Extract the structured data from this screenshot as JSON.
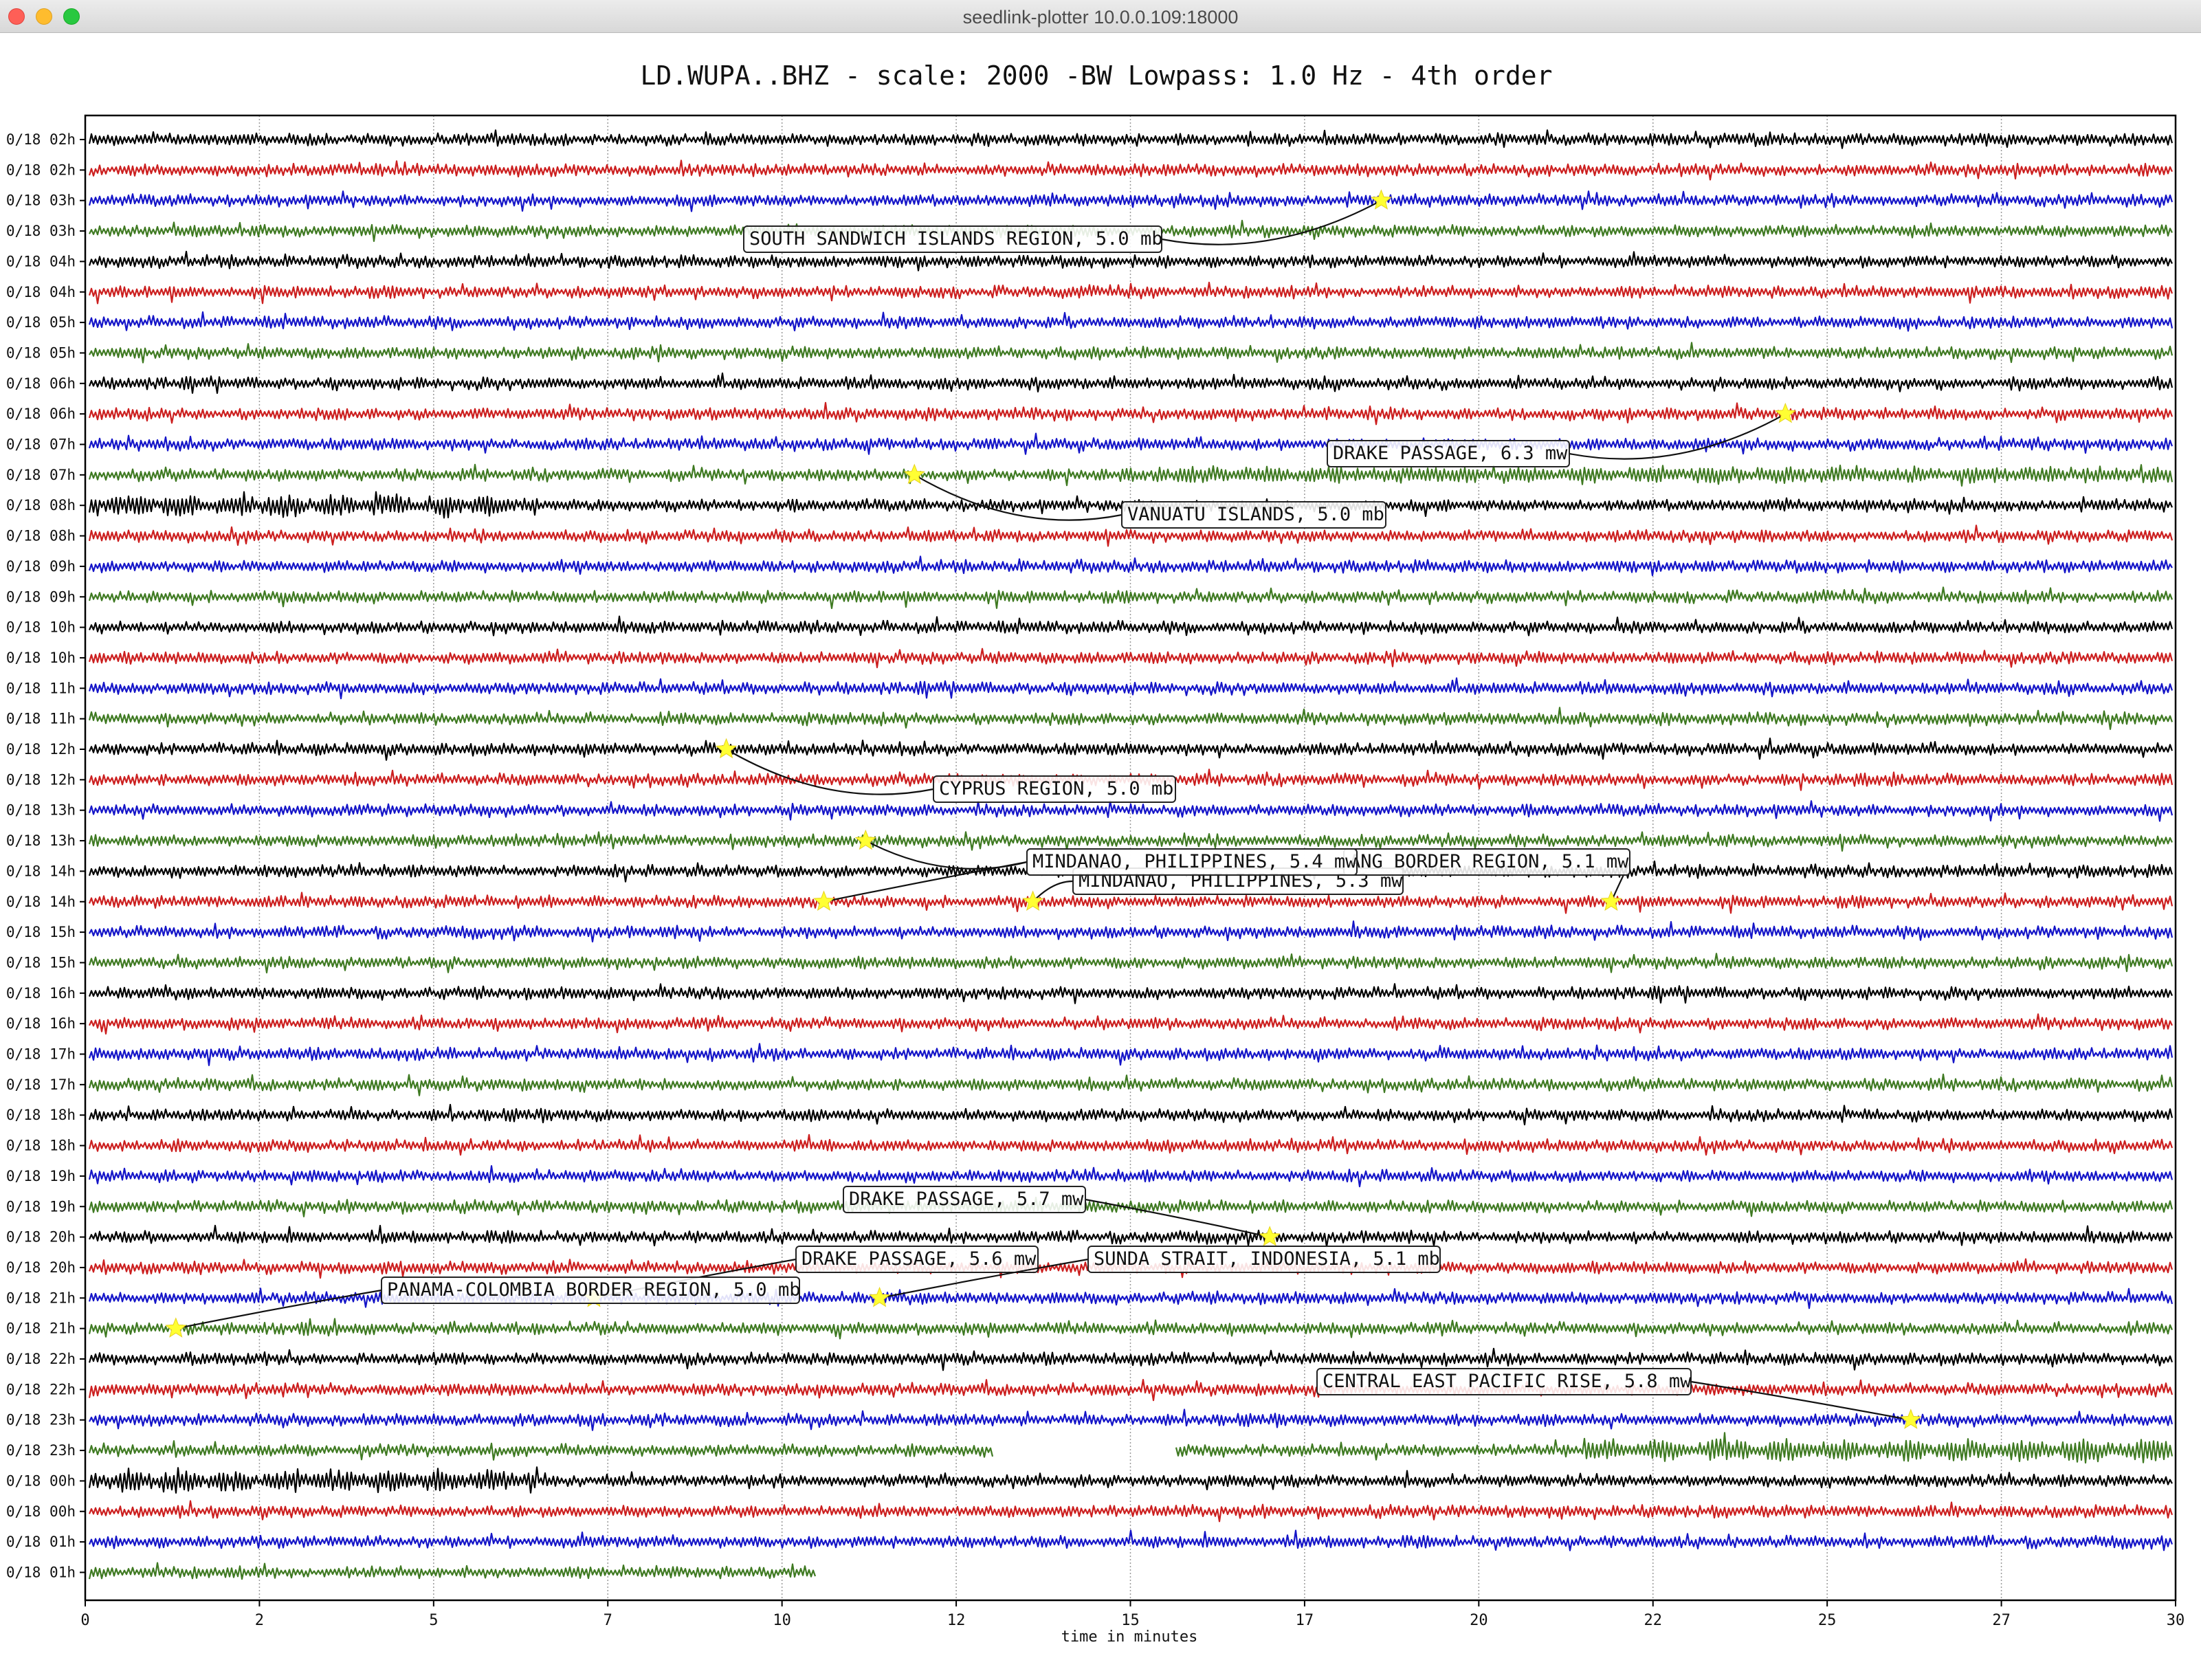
{
  "window": {
    "title": "seedlink-plotter 10.0.0.109:18000",
    "buttons": [
      "close",
      "minimize",
      "zoom"
    ]
  },
  "chart_data": {
    "type": "line",
    "title": "LD.WUPA..BHZ - scale: 2000 -BW Lowpass: 1.0 Hz - 4th order",
    "xlabel": "time in minutes",
    "ylabel": "",
    "xlim": [
      0,
      30
    ],
    "x_ticks": [
      "0",
      "2",
      "5",
      "7",
      "10",
      "12",
      "15",
      "17",
      "20",
      "22",
      "25",
      "27",
      "30"
    ],
    "grid": true,
    "line_colors": [
      "#000000",
      "#cc1f1f",
      "#1515c8",
      "#3f7a22"
    ],
    "row_labels": [
      "0/18 02h",
      "0/18 02h",
      "0/18 03h",
      "0/18 03h",
      "0/18 04h",
      "0/18 04h",
      "0/18 05h",
      "0/18 05h",
      "0/18 06h",
      "0/18 06h",
      "0/18 07h",
      "0/18 07h",
      "0/18 08h",
      "0/18 08h",
      "0/18 09h",
      "0/18 09h",
      "0/18 10h",
      "0/18 10h",
      "0/18 11h",
      "0/18 11h",
      "0/18 12h",
      "0/18 12h",
      "0/18 13h",
      "0/18 13h",
      "0/18 14h",
      "0/18 14h",
      "0/18 15h",
      "0/18 15h",
      "0/18 16h",
      "0/18 16h",
      "0/18 17h",
      "0/18 17h",
      "0/18 18h",
      "0/18 18h",
      "0/18 19h",
      "0/18 19h",
      "0/18 20h",
      "0/18 20h",
      "0/18 21h",
      "0/18 21h",
      "0/18 22h",
      "0/18 22h",
      "0/18 23h",
      "0/18 23h",
      "0/18 00h",
      "0/18 00h",
      "0/18 01h",
      "0/18 01h"
    ],
    "events": [
      {
        "label": "SOUTH SANDWICH ISLANDS REGION, 5.0 mb",
        "row": 2,
        "minute": 18.6
      },
      {
        "label": "DRAKE PASSAGE, 6.3 mw",
        "row": 9,
        "minute": 24.4
      },
      {
        "label": "VANUATU ISLANDS, 5.0 mb",
        "row": 11,
        "minute": 11.9
      },
      {
        "label": "CYPRUS REGION, 5.0 mb",
        "row": 20,
        "minute": 9.2
      },
      {
        "label": "MINDANAO, PHILIPPINES, 5.4 mw",
        "row": 23,
        "minute": 11.2
      },
      {
        "label": "MINDANAO, PHILIPPINES, 5.3 mw",
        "row": 25,
        "minute": 13.6
      },
      {
        "label": "ANG BORDER REGION, 5.1 mw",
        "row": 25,
        "minute": 21.9
      },
      {
        "label": "MINDANAO, PHILIPPINES, 5.4 mw",
        "row": 25,
        "minute": 10.6
      },
      {
        "label": "DRAKE PASSAGE, 5.7 mw",
        "row": 36,
        "minute": 17.0
      },
      {
        "label": "DRAKE PASSAGE, 5.6 mw",
        "row": 38,
        "minute": 7.3
      },
      {
        "label": "SUNDA STRAIT, INDONESIA, 5.1 mb",
        "row": 38,
        "minute": 11.4
      },
      {
        "label": "PANAMA-COLOMBIA BORDER REGION, 5.0 mb",
        "row": 39,
        "minute": 1.3
      },
      {
        "label": "CENTRAL EAST PACIFIC RISE, 5.8 mw",
        "row": 42,
        "minute": 26.2
      }
    ]
  }
}
